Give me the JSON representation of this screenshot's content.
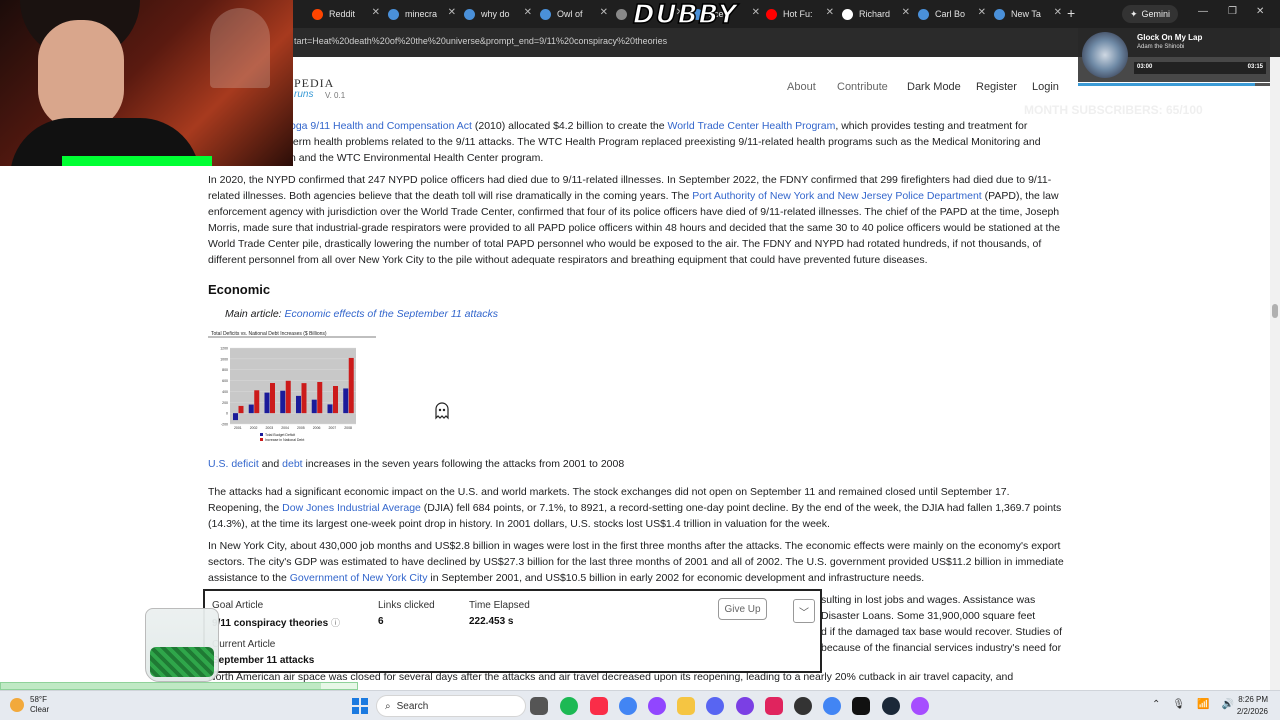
{
  "browser": {
    "tabs": [
      {
        "title": "Reddit",
        "color": "#ff4500"
      },
      {
        "title": "minecra",
        "color": "#4a90d9"
      },
      {
        "title": "why do",
        "color": "#4a90d9"
      },
      {
        "title": "Owl of",
        "color": "#4a90d9"
      },
      {
        "title": "",
        "color": "#888888"
      },
      {
        "title": "nce",
        "color": "#4a90d9"
      },
      {
        "title": "Hot Fu:",
        "color": "#ff0000"
      },
      {
        "title": "Richard",
        "color": "#ffffff"
      },
      {
        "title": "Carl Bo",
        "color": "#4a90d9"
      },
      {
        "title": "New Ta",
        "color": "#4a90d9"
      }
    ],
    "gemini_label": "Gemini",
    "url": "tart=Heat%20death%20of%20the%20universe&prompt_end=9/11%20conspiracy%20theories"
  },
  "site": {
    "logo_text": "PEDIA",
    "logo_sub": "runs",
    "version": "V. 0.1",
    "nav": {
      "about": "About",
      "contribute": "Contribute",
      "dark_mode": "Dark Mode",
      "register": "Register",
      "login": "Login"
    }
  },
  "article": {
    "p1": {
      "link1": "oga 9/11 Health and Compensation Act",
      "t1": " (2010) allocated $4.2 billion to create the ",
      "link2": "World Trade Center Health Program",
      "t2": ", which provides testing and treatment for",
      "line2": "term health problems related to the 9/11 attacks. The WTC Health Program replaced preexisting 9/11-related health programs such as the Medical Monitoring and",
      "line3": "n and the WTC Environmental Health Center program."
    },
    "p2": {
      "t1": "In 2020, the NYPD confirmed that 247 NYPD police officers had died due to 9/11-related illnesses. In September 2022, the FDNY confirmed that 299 firefighters had died due to 9/11-related illnesses. Both agencies believe that the death toll will rise dramatically in the coming years. The ",
      "link": "Port Authority of New York and New Jersey Police Department",
      "t2": " (PAPD), the law enforcement agency with jurisdiction over the World Trade Center, confirmed that four of its police officers have died of 9/11-related illnesses. The chief of the PAPD at the time, Joseph Morris, made sure that industrial-grade respirators were provided to all PAPD police officers within 48 hours and decided that the same 30 to 40 police officers would be stationed at the World Trade Center pile, drastically lowering the number of total PAPD personnel who would be exposed to the air. The FDNY and NYPD had rotated hundreds, if not thousands, of different personnel from all over New York City to the pile without adequate respirators and breathing equipment that could have prevented future diseases."
    },
    "econ_heading": "Economic",
    "main_article_prefix": "Main article: ",
    "main_article_link": "Economic effects of the September 11 attacks",
    "caption": {
      "link1": "U.S. deficit",
      "t1": " and ",
      "link2": "debt",
      "t2": " increases in the seven years following the attacks from 2001 to 2008"
    },
    "p3": {
      "t1": "The attacks had a significant economic impact on the U.S. and world markets. The stock exchanges did not open on September 11 and remained closed until September 17. Reopening, the ",
      "link": "Dow Jones Industrial Average",
      "t2": " (DJIA) fell 684 points, or 7.1%, to 8921, a record-setting one-day point decline. By the end of the week, the DJIA had fallen 1,369.7 points (14.3%), at the time its largest one-week point drop in history. In 2001 dollars, U.S. stocks lost US$1.4 trillion in valuation for the week."
    },
    "p4": {
      "t1": "In New York City, about 430,000 job months and US$2.8 billion in wages were lost in the first three months after the attacks. The economic effects were mainly on the economy's export sectors. The city's GDP was estimated to have declined by US$27.3 billion for the last three months of 2001 and all of 2002. The U.S. government provided US$11.2 billion in immediate assistance to the ",
      "link": "Government of New York City",
      "t2": " in September 2001, and US$10.5 billion in early 2002 for economic development and infrastructure needs."
    },
    "partial_right": [
      "sulting in lost jobs and wages. Assistance was",
      "Disaster Loans. Some 31,900,000 square feet",
      "d if the damaged tax base would recover. Studies of",
      "because of the financial services industry's need for"
    ],
    "bottom_line": "North American air space was closed for several days after the attacks and air travel decreased upon its reopening, leading to a nearly 20% cutback in air travel capacity, and"
  },
  "chart_data": {
    "type": "bar",
    "title": "Total Deficits vs. National Debt Increases ($ Billions)",
    "categories": [
      "2001",
      "2002",
      "2003",
      "2004",
      "2005",
      "2006",
      "2007",
      "2008"
    ],
    "series": [
      {
        "name": "Total Budget Deficit",
        "color": "#1b1b9a",
        "values": [
          -128,
          158,
          378,
          413,
          318,
          248,
          161,
          455
        ]
      },
      {
        "name": "Increase in National Debt",
        "color": "#cc1b1b",
        "values": [
          133,
          421,
          555,
          596,
          553,
          574,
          500,
          1017
        ]
      }
    ],
    "ylim": [
      -200,
      1200
    ],
    "legend": "bottom"
  },
  "game": {
    "goal_label": "Goal Article",
    "goal_value": "9/11 conspiracy theories",
    "links_label": "Links clicked",
    "links_value": "6",
    "time_label": "Time Elapsed",
    "time_value": "222.453 s",
    "current_label": "Current Article",
    "current_value": "September 11 attacks",
    "give_up": "Give Up"
  },
  "stream": {
    "logo": "DUBBY",
    "music_title": "Glock On My Lap",
    "music_artist": "Adam the Shinobi",
    "music_elapsed": "03:00",
    "music_total": "03:15",
    "music_progress": 0.92,
    "sub_goal": "MONTH SUBSCRIBERS: 65/100",
    "hype_progress": 0.9
  },
  "taskbar": {
    "temp": "58°F",
    "condition": "Clear",
    "search": "Search",
    "time": "8:26 PM",
    "date": "2/2/2026"
  }
}
